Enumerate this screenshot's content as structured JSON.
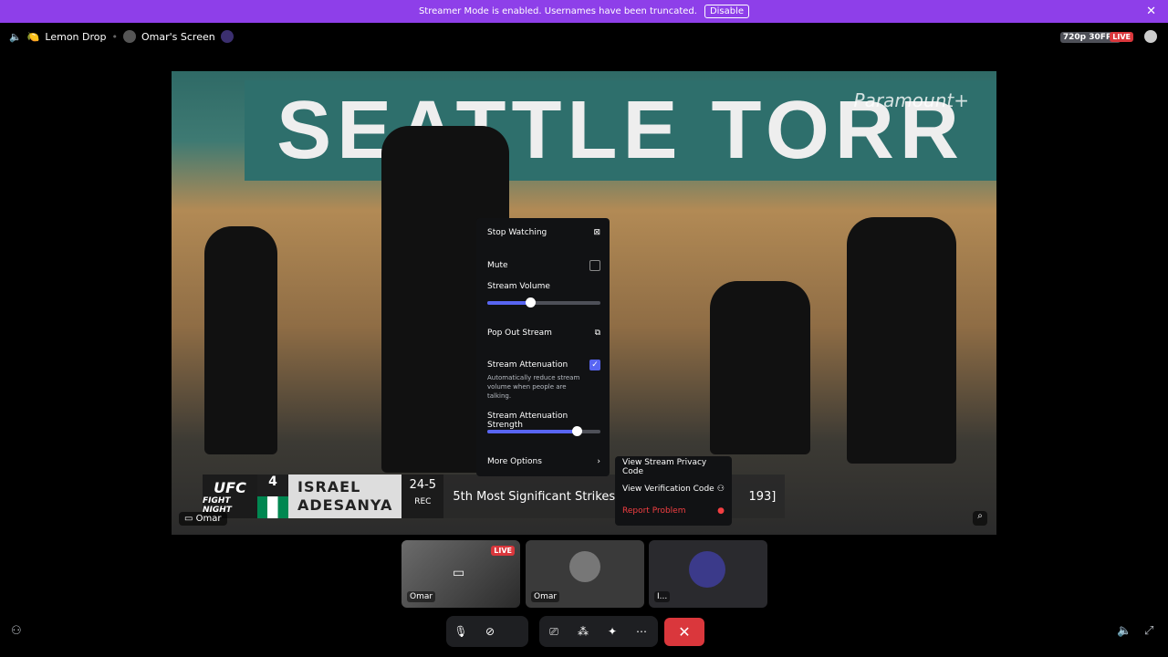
{
  "banner": {
    "text": "Streamer Mode is enabled. Usernames have been truncated.",
    "button": "Disable"
  },
  "header": {
    "channel": "Lemon Drop",
    "screen": "Omar's Screen",
    "quality": "720p 30FPS",
    "live": "LIVE"
  },
  "stream": {
    "sign": "SEATTLE TORR",
    "watermark": "Paramount+",
    "owner": "Omar",
    "lower_third": {
      "logo_top": "UFC",
      "logo_bottom": "FIGHT NIGHT",
      "rank": "4",
      "name_line1": "ISRAEL",
      "name_line2": "ADESANYA",
      "record": "24-5",
      "record_label": "REC",
      "stat": "5th Most Significant Strikes In UFC",
      "stat_tail": "193]"
    }
  },
  "menu": {
    "stop_watching": "Stop Watching",
    "mute": "Mute",
    "stream_volume": "Stream Volume",
    "stream_volume_level": 0.38,
    "pop_out": "Pop Out Stream",
    "attenuation": "Stream Attenuation",
    "attenuation_desc": "Automatically reduce stream volume when people are talking.",
    "attenuation_checked": true,
    "attenuation_strength": "Stream Attenuation Strength",
    "attenuation_strength_level": 0.79,
    "more_options": "More Options"
  },
  "submenu": {
    "privacy": "View Stream Privacy Code",
    "verification": "View Verification Code",
    "report": "Report Problem"
  },
  "thumbnails": [
    {
      "label": "Omar",
      "live": "LIVE"
    },
    {
      "label": "Omar"
    },
    {
      "label": "I..."
    }
  ],
  "colors": {
    "banner": "#8e3fe9",
    "accent": "#5865f2",
    "danger": "#da373c"
  }
}
